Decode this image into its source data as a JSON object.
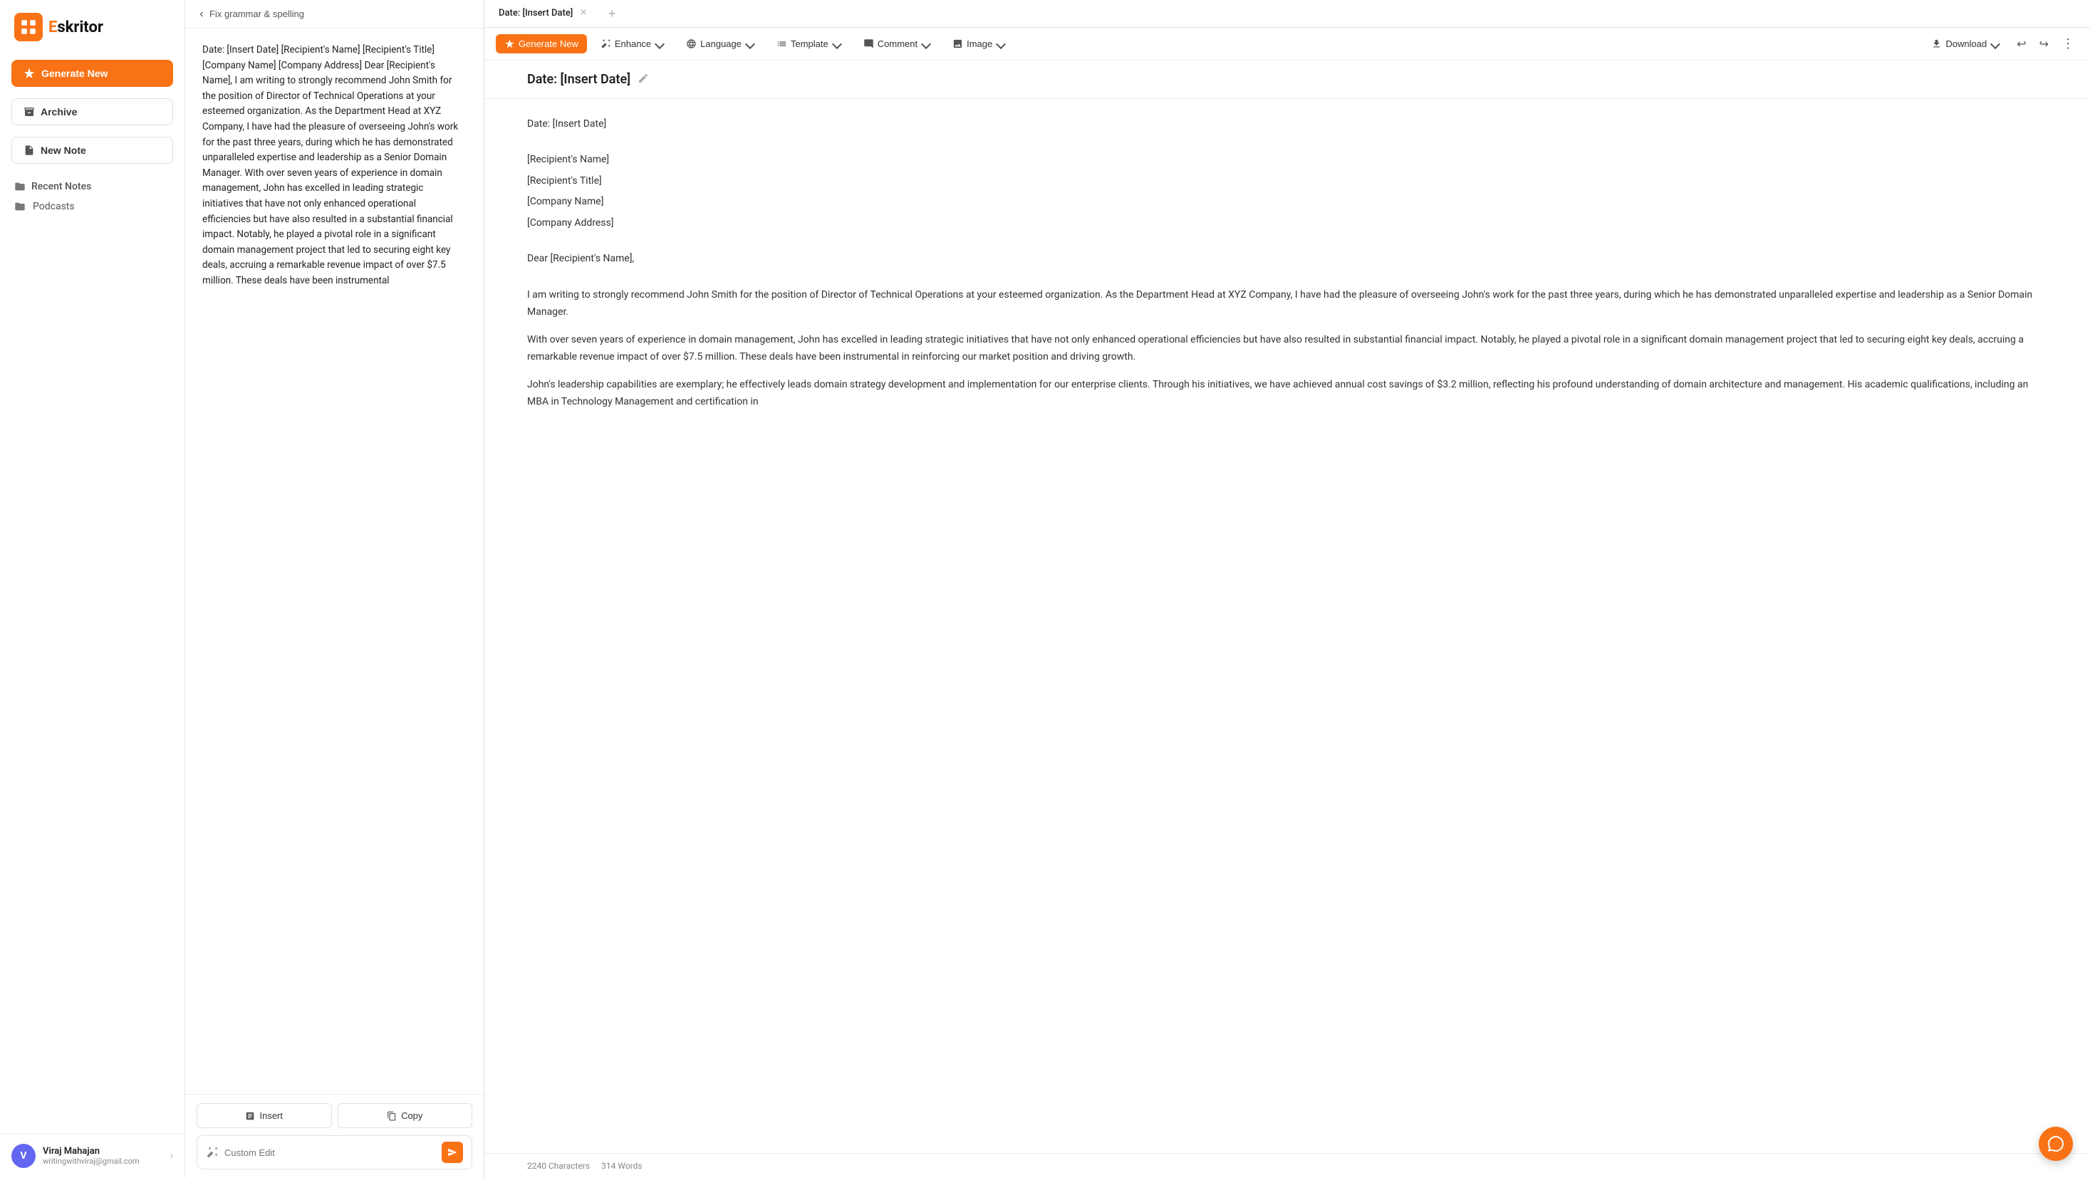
{
  "app": {
    "name": "Eskritor",
    "logo_letter": "E"
  },
  "sidebar": {
    "generate_label": "Generate New",
    "archive_label": "Archive",
    "new_note_label": "New Note",
    "recent_notes_label": "Recent Notes",
    "podcasts_label": "Podcasts",
    "user": {
      "name": "Viraj Mahajan",
      "email": "writingwithviraj@gmail.com",
      "initials": "V"
    }
  },
  "preview": {
    "back_label": "Fix grammar & spelling",
    "content": "Date: [Insert Date] [Recipient's Name] [Recipient's Title] [Company Name] [Company Address] Dear [Recipient's Name], I am writing to strongly recommend John Smith for the position of Director of Technical Operations at your esteemed organization. As the Department Head at XYZ Company, I have had the pleasure of overseeing John's work for the past three years, during which he has demonstrated unparalleled expertise and leadership as a Senior Domain Manager. With over seven years of experience in domain management, John has excelled in leading strategic initiatives that have not only enhanced operational efficiencies but have also resulted in a substantial financial impact. Notably, he played a pivotal role in a significant domain management project that led to securing eight key deals, accruing a remarkable revenue impact of over $7.5 million. These deals have been instrumental",
    "insert_label": "Insert",
    "copy_label": "Copy",
    "custom_edit_placeholder": "Custom Edit"
  },
  "editor": {
    "tab_title": "Date: [Insert Date]",
    "doc_title": "Date: [Insert Date]",
    "toolbar": {
      "generate_label": "Generate New",
      "enhance_label": "Enhance",
      "language_label": "Language",
      "template_label": "Template",
      "comment_label": "Comment",
      "image_label": "Image",
      "download_label": "Download"
    },
    "content": {
      "line1": "Date: [Insert Date]",
      "line2": "[Recipient's Name]",
      "line3": "[Recipient's Title]",
      "line4": "[Company Name]",
      "line5": "[Company Address]",
      "line6": "Dear [Recipient's Name],",
      "para1": "I am writing to strongly recommend John Smith for the position of Director of Technical Operations at your esteemed organization. As the Department Head at XYZ Company, I have had the pleasure of overseeing John's work for the past three years, during which he has demonstrated unparalleled expertise and leadership as a Senior Domain Manager.",
      "para2": "With over seven years of experience in domain management, John has excelled in leading strategic initiatives that have not only enhanced operational efficiencies but have also resulted in substantial financial impact. Notably, he played a pivotal role in a significant domain management project that led to securing eight key deals, accruing a remarkable revenue impact of over $7.5 million. These deals have been instrumental in reinforcing our market position and driving growth.",
      "para3": "John's leadership capabilities are exemplary; he effectively leads domain strategy development and implementation for our enterprise clients. Through his initiatives, we have achieved annual cost savings of $3.2 million, reflecting his profound understanding of domain architecture and management. His academic qualifications, including an MBA in Technology Management and certification in"
    },
    "footer": {
      "characters_label": "2240 Characters",
      "words_label": "314 Words"
    }
  }
}
